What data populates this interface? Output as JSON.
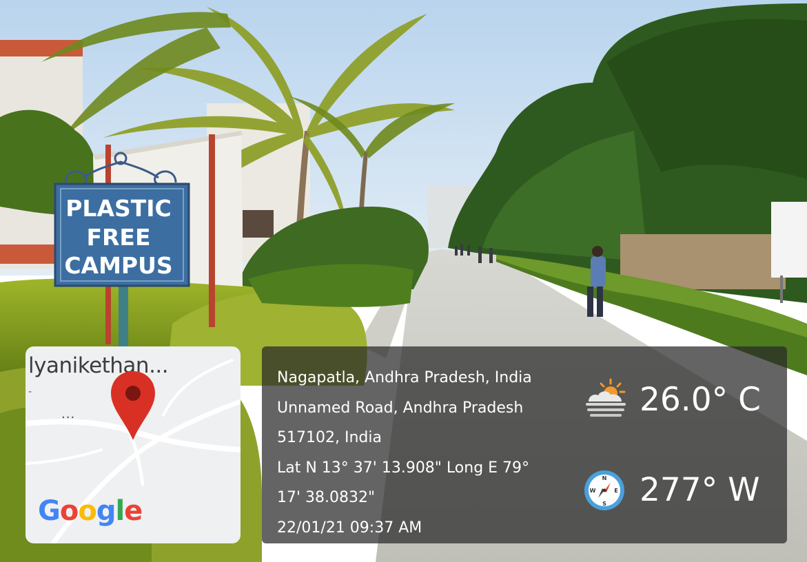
{
  "sign": {
    "line1": "PLASTIC",
    "line2": "FREE",
    "line3": "CAMPUS"
  },
  "map": {
    "place_label": "lyanikethan...",
    "dash": "-",
    "dots": "...",
    "google_logo": {
      "letters": [
        "G",
        "o",
        "o",
        "g",
        "l",
        "e"
      ],
      "colors": [
        "#4285F4",
        "#EA4335",
        "#FBBC05",
        "#4285F4",
        "#34A853",
        "#EA4335"
      ]
    },
    "pin_icon": "map-pin-icon",
    "pin_color": "#D93025"
  },
  "location": {
    "line1": "Nagapatla, Andhra Pradesh, India",
    "line2": "Unnamed Road, Andhra Pradesh",
    "line3": "517102, India",
    "line4": "Lat N 13° 37' 13.908\" Long E 79°",
    "line5": "17' 38.0832\"",
    "line6": "22/01/21 09:37 AM"
  },
  "weather": {
    "icon": "partly-sunny-icon",
    "temperature": "26.0° C"
  },
  "wind": {
    "icon": "compass-icon",
    "direction": "277° W"
  }
}
